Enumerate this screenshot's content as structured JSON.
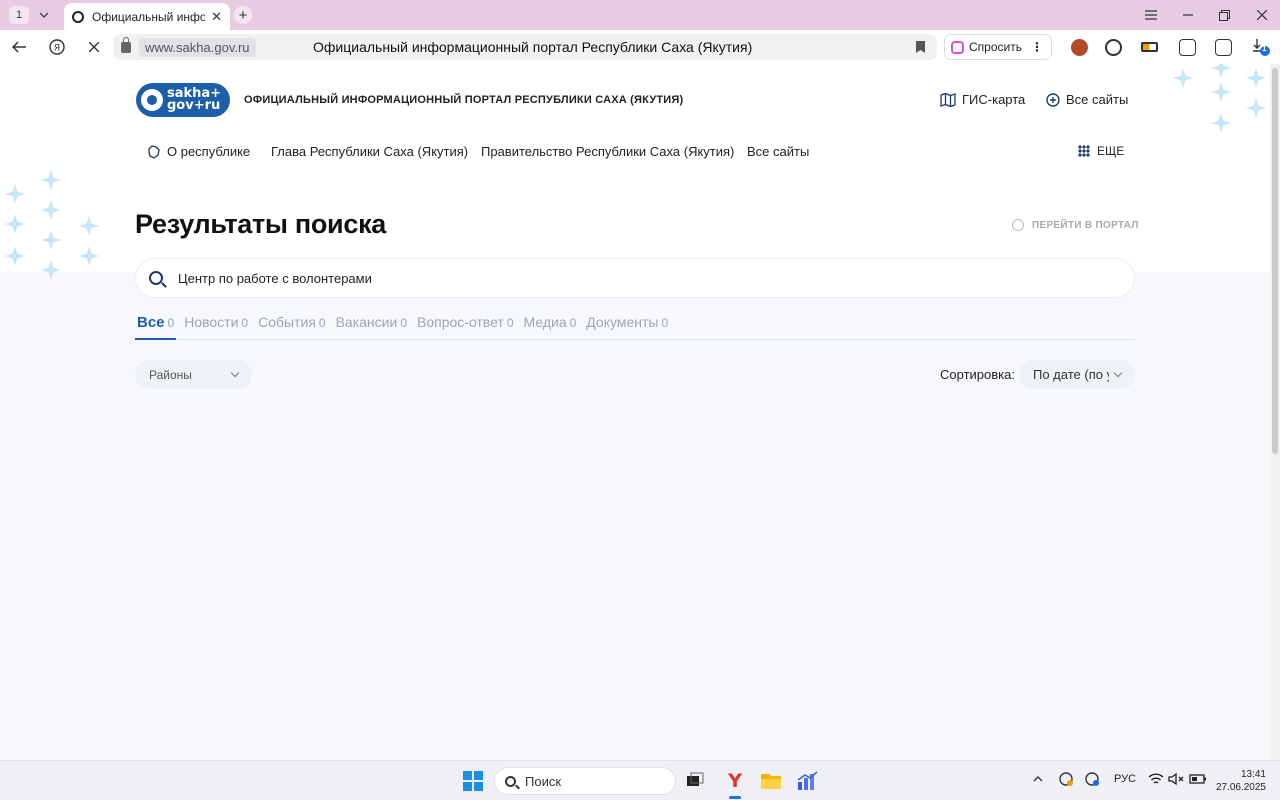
{
  "browser": {
    "tab_count": "1",
    "tab_title": "Официальный информ",
    "close_glyph": "✕",
    "new_tab_glyph": "+",
    "address_domain": "www.sakha.gov.ru",
    "page_title": "Официальный информационный портал Республики Саха (Якутия)",
    "ask_label": "Спросить",
    "ask_menu_glyph": "⋮",
    "download_badge": "1"
  },
  "header": {
    "logo_line1": "sakha+",
    "logo_line2": "gov+ru",
    "portal_name": "ОФИЦИАЛЬНЫЙ ИНФОРМАЦИОННЫЙ ПОРТАЛ РЕСПУБЛИКИ САХА (ЯКУТИЯ)",
    "gis_map": "ГИС-карта",
    "all_sites": "Все сайты"
  },
  "nav": {
    "items": [
      "О республике",
      "Глава Республики Саха (Якутия)",
      "Правительство Республики Саха (Якутия)",
      "Все сайты"
    ],
    "more": "ЕЩЕ"
  },
  "search": {
    "title": "Результаты поиска",
    "go_portal": "ПЕРЕЙТИ В ПОРТАЛ",
    "query": "Центр по работе с волонтерами",
    "tabs": [
      {
        "label": "Все",
        "count": "0"
      },
      {
        "label": "Новости",
        "count": "0"
      },
      {
        "label": "События",
        "count": "0"
      },
      {
        "label": "Вакансии",
        "count": "0"
      },
      {
        "label": "Вопрос-ответ",
        "count": "0"
      },
      {
        "label": "Медиа",
        "count": "0"
      },
      {
        "label": "Документы",
        "count": "0"
      }
    ],
    "districts": "Районы",
    "sort_label": "Сортировка:",
    "sort_value": "По дате (по у"
  },
  "taskbar": {
    "search_placeholder": "Поиск",
    "lang": "РУС",
    "time": "13:41",
    "date": "27.06.2025"
  },
  "colors": {
    "accent": "#1d5ea8",
    "tabstrip": "#e6cbe3",
    "sparkle": "#c7e6f7"
  }
}
